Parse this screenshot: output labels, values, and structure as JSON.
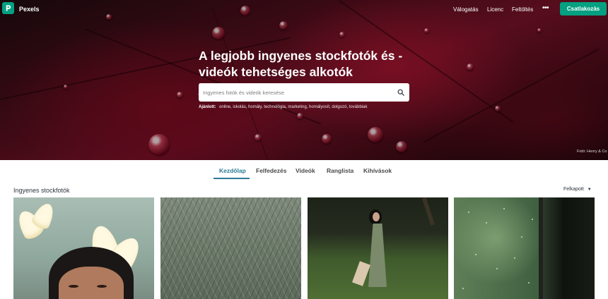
{
  "nav": {
    "brand": "Pexels",
    "links": [
      "Válogatás",
      "Licenc",
      "Feltöltés"
    ],
    "more": "•••",
    "join_label": "Csatlakozás"
  },
  "hero": {
    "title_line1": "A legjobb ingyenes stockfotók és -",
    "title_line2": "videók tehetséges alkotók jóvoltából.",
    "search_placeholder": "Ingyenes fotók és videók keresése",
    "suggest_label": "Ajánlott:",
    "suggestions": [
      "online",
      "iskolás",
      "homály",
      "technológia",
      "marketing",
      "homályosít",
      "dolgozó",
      "továbbiak"
    ],
    "credit": "Fotó: Henry & Co"
  },
  "tabs": [
    "Kezdőlap",
    "Felfedezés",
    "Videók",
    "Ranglista",
    "Kihívások"
  ],
  "active_tab": "Kezdőlap",
  "section": {
    "title": "Ingyenes stockfotók",
    "sort_label": "Felkapott",
    "sort_caret": "▼"
  },
  "colors": {
    "brand": "#05a081",
    "active_tab": "#2c7a95"
  },
  "icons": {
    "logo": "pexels-logo-icon",
    "search": "search-icon",
    "more": "more-icon"
  }
}
